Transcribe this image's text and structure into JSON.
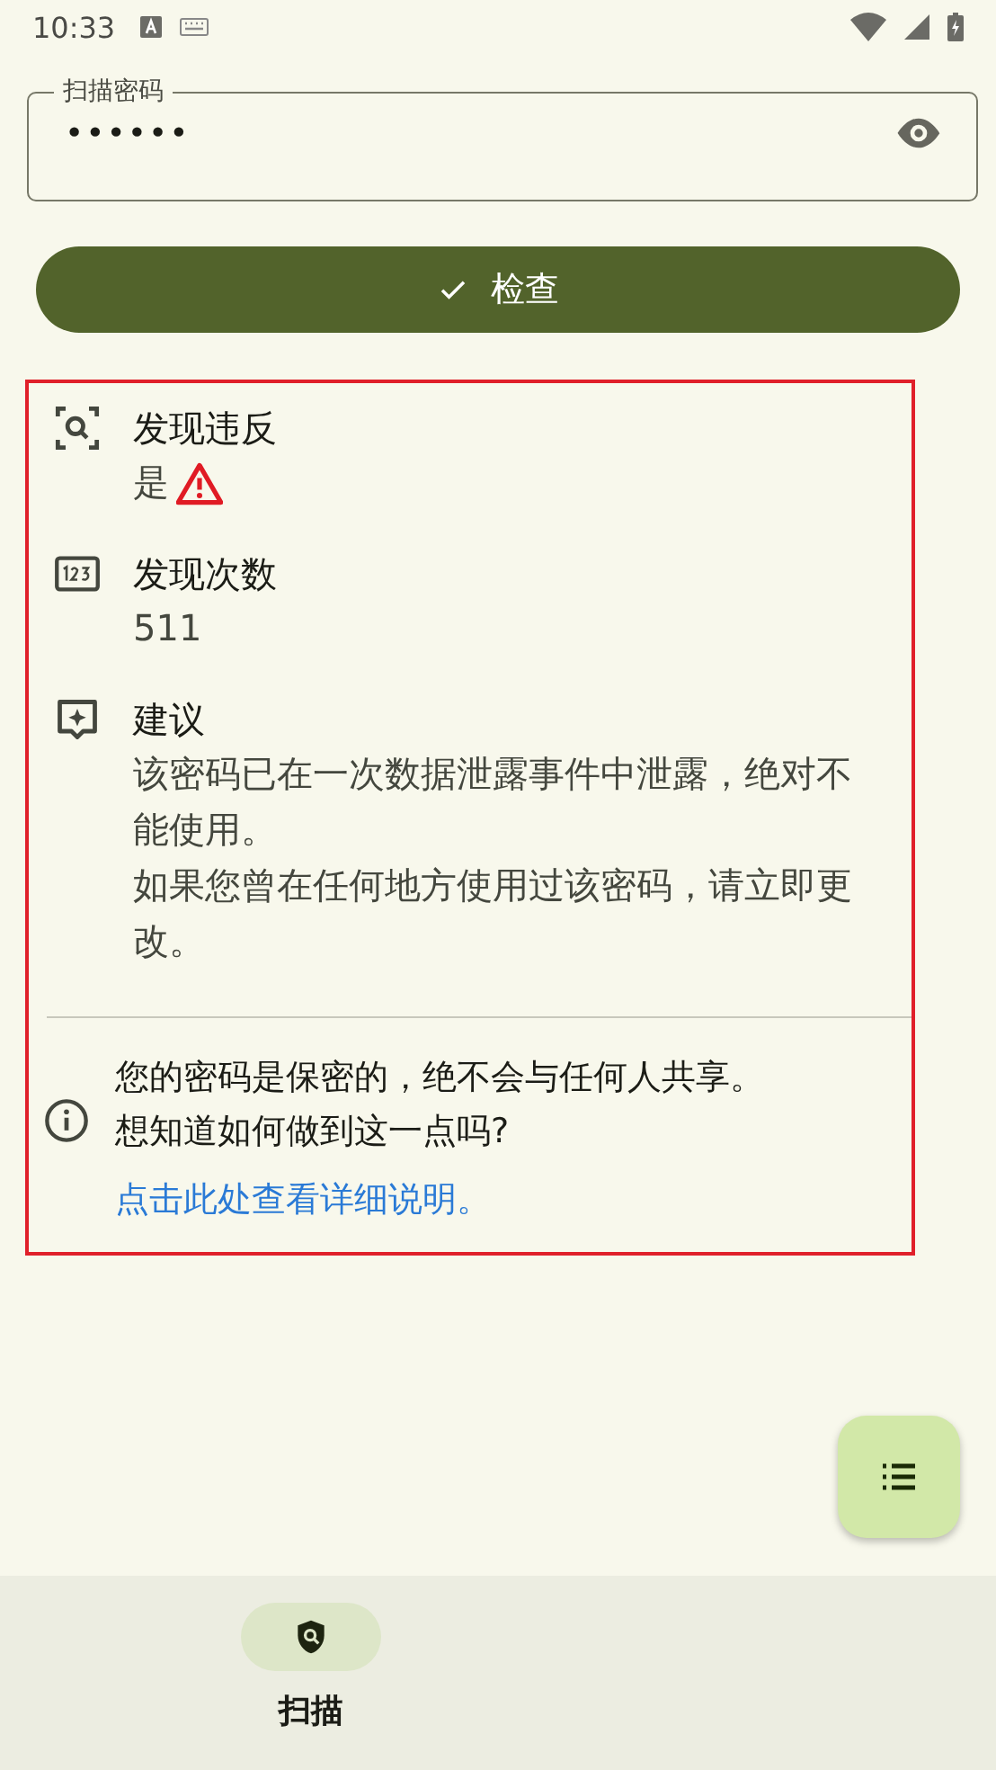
{
  "status_bar": {
    "time": "10:33"
  },
  "password_field": {
    "label": "扫描密码",
    "value": "••••••"
  },
  "check_button": {
    "label": "检查"
  },
  "results": [
    {
      "kind": "violation",
      "title": "发现违反",
      "lines": [
        "是"
      ],
      "warning": true
    },
    {
      "kind": "count",
      "title": "发现次数",
      "lines": [
        "511"
      ],
      "warning": false
    },
    {
      "kind": "advice",
      "title": "建议",
      "lines": [
        "该密码已在一次数据泄露事件中泄露，绝对不能使用。",
        "如果您曾在任何地方使用过该密码，请立即更改。"
      ],
      "warning": false
    }
  ],
  "privacy_note": {
    "lines": [
      "您的密码是保密的，绝不会与任何人共享。",
      "想知道如何做到这一点吗?"
    ],
    "link": "点击此处查看详细说明。"
  },
  "nav": [
    {
      "label": "扫描",
      "selected": true
    }
  ]
}
